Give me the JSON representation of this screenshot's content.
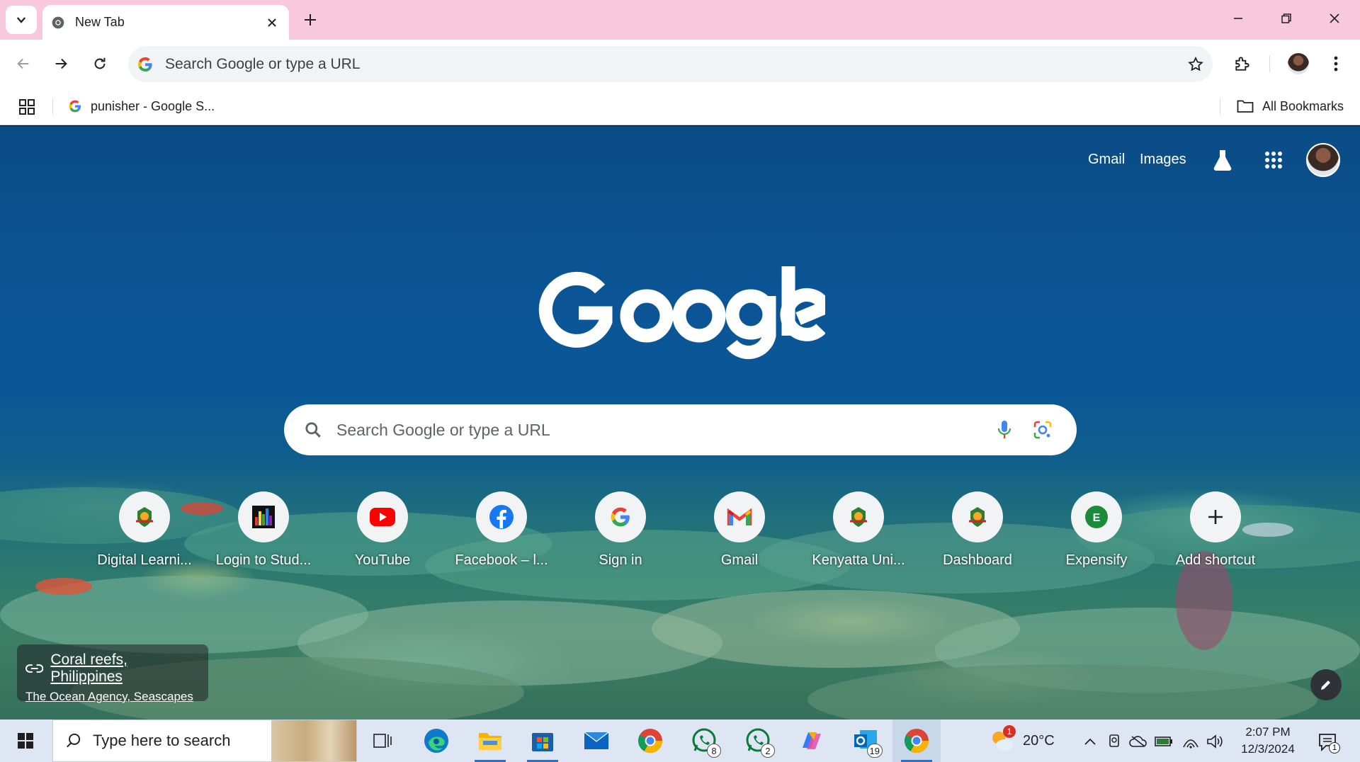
{
  "tab": {
    "title": "New Tab"
  },
  "omnibox": {
    "placeholder": "Search Google or type a URL"
  },
  "bookmarks": {
    "item1": "punisher - Google S...",
    "all": "All Bookmarks"
  },
  "header_links": {
    "gmail": "Gmail",
    "images": "Images"
  },
  "search": {
    "placeholder": "Search Google or type a URL"
  },
  "shortcuts": [
    {
      "label": "Digital Learni...",
      "icon": "kenyatta-crest-icon"
    },
    {
      "label": "Login to Stud...",
      "icon": "bar-chart-icon"
    },
    {
      "label": "YouTube",
      "icon": "youtube-icon"
    },
    {
      "label": "Facebook – l...",
      "icon": "facebook-icon"
    },
    {
      "label": "Sign in",
      "icon": "google-g-icon"
    },
    {
      "label": "Gmail",
      "icon": "gmail-icon"
    },
    {
      "label": "Kenyatta Uni...",
      "icon": "kenyatta-crest-icon"
    },
    {
      "label": "Dashboard",
      "icon": "kenyatta-crest-icon"
    },
    {
      "label": "Expensify",
      "icon": "expensify-icon"
    },
    {
      "label": "Add shortcut",
      "icon": "plus-icon"
    }
  ],
  "attribution": {
    "title": "Coral reefs, Philippines",
    "credit": "The Ocean Agency, Seascapes"
  },
  "taskbar": {
    "search_placeholder": "Type here to search",
    "whatsapp_badge_1": "8",
    "whatsapp_badge_2": "2",
    "outlook_badge": "19",
    "weather_badge": "1",
    "temperature": "20°C",
    "time": "2:07 PM",
    "date": "12/3/2024",
    "notifications": "1"
  },
  "colors": {
    "tabstrip": "#f8c9dc",
    "accent": "#1a73e8",
    "taskbar": "#dde6f2"
  }
}
